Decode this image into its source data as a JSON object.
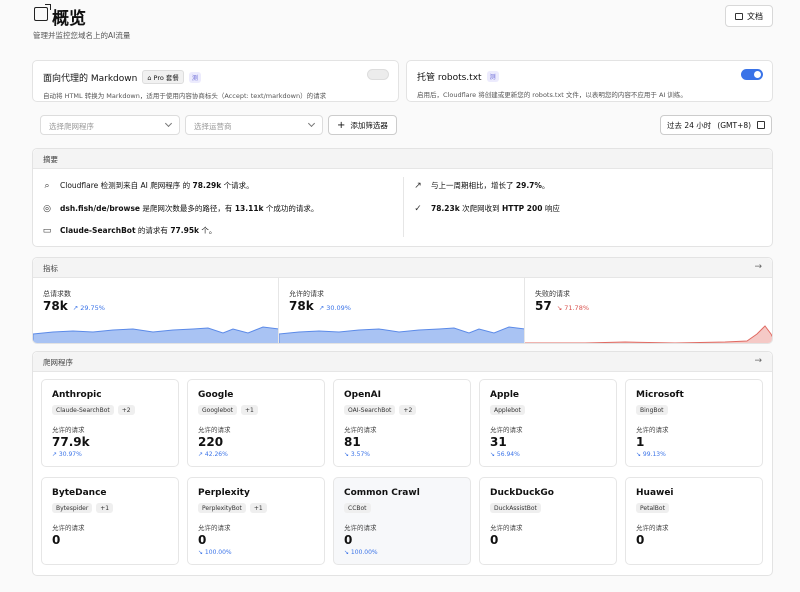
{
  "header": {
    "title": "概览",
    "subtitle": "管理并监控您域名上的AI流量",
    "doc_label": "文档"
  },
  "features": [
    {
      "title": "面向代理的 Markdown",
      "badge": "Pro 套餐",
      "beta": "测",
      "desc": "自动将 HTML 转换为 Markdown，适用于使用内容协商标头（Accept: text/markdown）的请求",
      "enabled": false
    },
    {
      "title": "托管 robots.txt",
      "beta": "测",
      "desc": "启用后，Cloudflare 将创建或更新您的 robots.txt 文件，以表明您的内容不应用于 AI 训练。",
      "enabled": true
    }
  ],
  "filters": {
    "crawler_placeholder": "选择爬网程序",
    "operator_placeholder": "选择运营商",
    "add_filter": "添加筛选器",
    "time_range": "过去 24 小时",
    "timezone": "(GMT+8)"
  },
  "summary": {
    "title": "摘要",
    "items": [
      {
        "icon": "magnify-icon",
        "pre": "Cloudflare 检测到来自 AI 爬网程序 的 ",
        "bold": "78.29k",
        "post": " 个请求。"
      },
      {
        "icon": "globe-icon",
        "bold": "dsh.fish/de/browse",
        "pre": "",
        "post": " 是爬网次数最多的路径，有 ",
        "bold2": "13.11k",
        "post2": " 个成功的请求。"
      },
      {
        "icon": "robot-icon",
        "bold": "Claude-SearchBot",
        "pre": "",
        "post": " 的请求有 ",
        "bold2": "77.95k",
        "post2": " 个。"
      },
      {
        "icon": "arrow-up-right-icon",
        "pre": "与上一周期相比，增长了 ",
        "bold": "29.7%",
        "post": "。"
      },
      {
        "icon": "check-icon",
        "pre": "",
        "bold": "78.23k",
        "post": " 次爬网收到 ",
        "bold2": "HTTP 200",
        "post2": " 响应"
      }
    ]
  },
  "metrics": {
    "title": "指标",
    "items": [
      {
        "label": "总请求数",
        "value": "78k",
        "trend": "↗ 29.75%",
        "dir": "up"
      },
      {
        "label": "允许的请求",
        "value": "78k",
        "trend": "↗ 30.09%",
        "dir": "up"
      },
      {
        "label": "失败的请求",
        "value": "57",
        "trend": "↘ 71.78%",
        "dir": "down"
      }
    ]
  },
  "crawlers": {
    "title": "爬网程序",
    "allowed_label": "允许的请求",
    "items": [
      {
        "name": "Anthropic",
        "tags": [
          "Claude-SearchBot",
          "+2"
        ],
        "value": "77.9k",
        "trend": "↗ 30.97%"
      },
      {
        "name": "Google",
        "tags": [
          "Googlebot",
          "+1"
        ],
        "value": "220",
        "trend": "↗ 42.26%"
      },
      {
        "name": "OpenAI",
        "tags": [
          "OAI-SearchBot",
          "+2"
        ],
        "value": "81",
        "trend": "↘ 3.57%"
      },
      {
        "name": "Apple",
        "tags": [
          "Applebot"
        ],
        "value": "31",
        "trend": "↘ 56.94%"
      },
      {
        "name": "Microsoft",
        "tags": [
          "BingBot"
        ],
        "value": "1",
        "trend": "↘ 99.13%"
      },
      {
        "name": "ByteDance",
        "tags": [
          "Bytespider",
          "+1"
        ],
        "value": "0",
        "trend": ""
      },
      {
        "name": "Perplexity",
        "tags": [
          "PerplexityBot",
          "+1"
        ],
        "value": "0",
        "trend": "↘ 100.00%"
      },
      {
        "name": "Common Crawl",
        "tags": [
          "CCBot"
        ],
        "value": "0",
        "trend": "↘ 100.00%"
      },
      {
        "name": "DuckDuckGo",
        "tags": [
          "DuckAssistBot"
        ],
        "value": "0",
        "trend": ""
      },
      {
        "name": "Huawei",
        "tags": [
          "PetalBot"
        ],
        "value": "0",
        "trend": ""
      }
    ]
  },
  "colors": {
    "accent": "#3a73e8",
    "danger": "#d9534f"
  }
}
